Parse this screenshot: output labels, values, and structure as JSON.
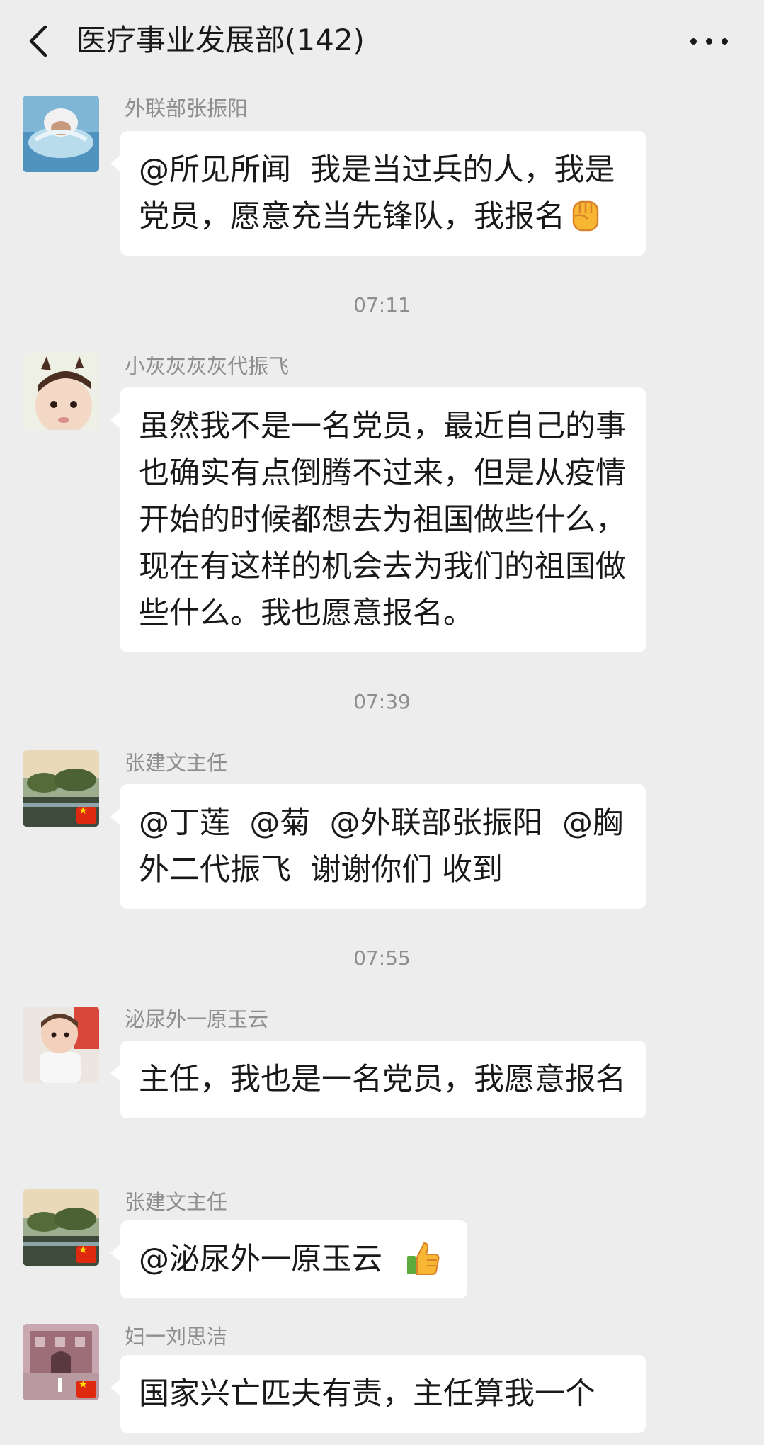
{
  "header": {
    "title": "医疗事业发展部(142)",
    "back_icon": "chevron-left-icon",
    "more_icon": "more-horizontal-icon"
  },
  "messages": [
    {
      "sender": "外联部张振阳",
      "avatar": "swimmer-photo",
      "text": "@所见所闻  我是当过兵的人，我是党员，愿意充当先锋队，我报名",
      "emoji": "raised-fist-emoji"
    },
    {
      "sender": "小灰灰灰灰代振飞",
      "avatar": "baby-photo",
      "text": "虽然我不是一名党员，最近自己的事也确实有点倒腾不过来，但是从疫情开始的时候都想去为祖国做些什么，现在有这样的机会去为我们的祖国做些什么。我也愿意报名。"
    },
    {
      "sender": "张建文主任",
      "avatar": "landscape-photo",
      "flag": "china-flag-icon",
      "text": "@丁莲  @菊  @外联部张振阳  @胸外二代振飞  谢谢你们 收到"
    },
    {
      "sender": "泌尿外一原玉云",
      "avatar": "child-photo",
      "text": "主任，我也是一名党员，我愿意报名"
    },
    {
      "sender": "张建文主任",
      "avatar": "landscape-photo",
      "flag": "china-flag-icon",
      "text": "@泌尿外一原玉云  ",
      "emoji": "thumbs-up-emoji"
    },
    {
      "sender": "妇一刘思洁",
      "avatar": "building-photo",
      "flag": "china-flag-icon",
      "text": "国家兴亡匹夫有责，主任算我一个"
    }
  ],
  "timestamps": [
    "07:11",
    "07:39",
    "07:55"
  ],
  "colors": {
    "background": "#EDEDED",
    "bubble": "#FFFFFF",
    "text": "#191919",
    "meta_text": "#8E8E8E",
    "flag_red": "#DE2910",
    "flag_star": "#FFDE00"
  }
}
